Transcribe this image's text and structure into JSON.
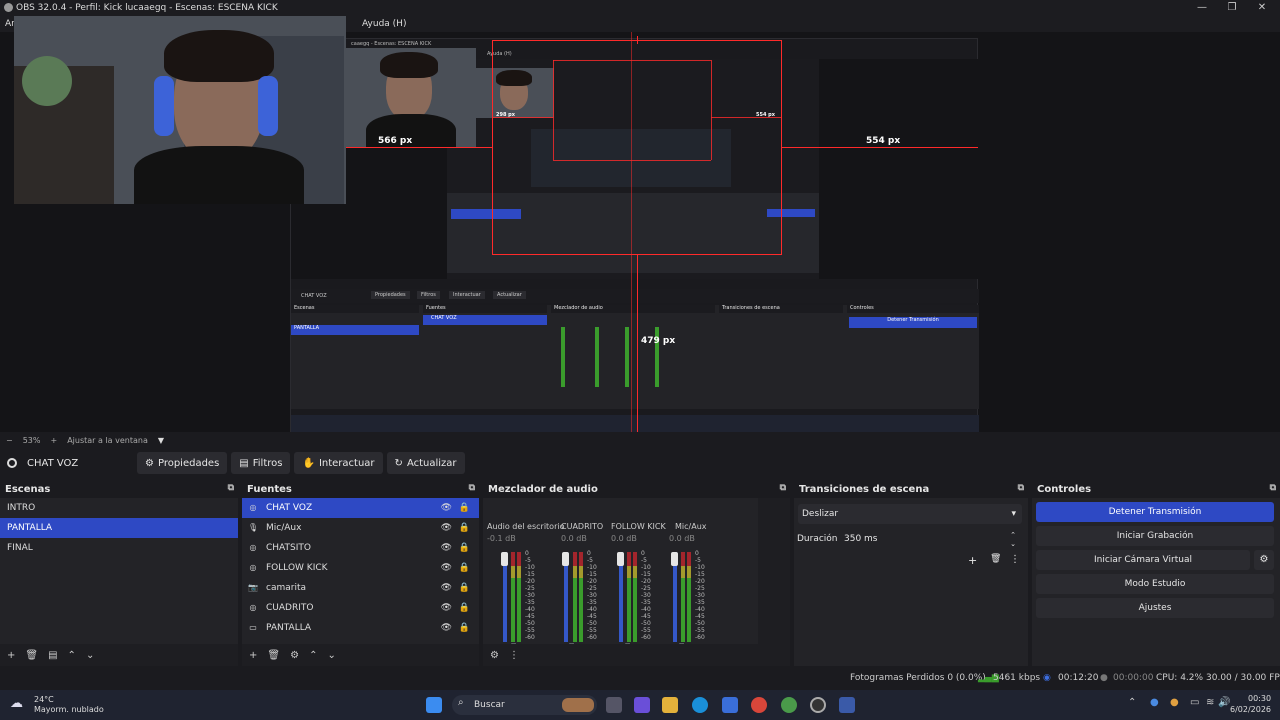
{
  "window": {
    "title": "OBS 32.0.4 - Perfil: Kick lucaaegq - Escenas: ESCENA KICK",
    "menu_help": "Ayuda (H)",
    "menu_first": "Ar"
  },
  "preview": {
    "px_left": "566 px",
    "px_right": "554 px",
    "px_bottom": "479 px",
    "px_small": "554 px",
    "px_small2": "298 px",
    "nested_title": "caaegq - Escenas: ESCENA KICK",
    "nested_help": "Ayuda (H)"
  },
  "zoom": {
    "minus": "−",
    "value": "53%",
    "plus": "+",
    "fit_label": "Ajustar a la ventana"
  },
  "toolbar": {
    "current_source": "CHAT VOZ",
    "properties": "Propiedades",
    "filters": "Filtros",
    "interact": "Interactuar",
    "refresh": "Actualizar"
  },
  "scenes": {
    "title": "Escenas",
    "items": [
      "INTRO",
      "PANTALLA",
      "FINAL"
    ],
    "selected": "PANTALLA"
  },
  "sources": {
    "title": "Fuentes",
    "items": [
      {
        "label": "CHAT VOZ",
        "icon": "browser-icon"
      },
      {
        "label": "Mic/Aux",
        "icon": "mic-icon"
      },
      {
        "label": "CHATSITO",
        "icon": "browser-icon"
      },
      {
        "label": "FOLLOW KICK",
        "icon": "browser-icon"
      },
      {
        "label": "camarita",
        "icon": "camera-icon"
      },
      {
        "label": "CUADRITO",
        "icon": "browser-icon"
      },
      {
        "label": "PANTALLA",
        "icon": "monitor-icon"
      }
    ]
  },
  "mixer": {
    "title": "Mezclador de audio",
    "channels": [
      {
        "name": "Audio del escritorio",
        "db": "-0.1 dB"
      },
      {
        "name": "CUADRITO",
        "db": "0.0 dB"
      },
      {
        "name": "FOLLOW KICK",
        "db": "0.0 dB"
      },
      {
        "name": "Mic/Aux",
        "db": "0.0 dB"
      }
    ],
    "scale": [
      "0",
      "-5",
      "-10",
      "-15",
      "-20",
      "-25",
      "-30",
      "-35",
      "-40",
      "-45",
      "-50",
      "-55",
      "-60"
    ]
  },
  "transitions": {
    "title": "Transiciones de escena",
    "selected": "Deslizar",
    "duration_label": "Duración",
    "duration_value": "350 ms"
  },
  "controls": {
    "title": "Controles",
    "stop_stream": "Detener Transmisión",
    "start_recording": "Iniciar Grabación",
    "start_virtual_cam": "Iniciar Cámara Virtual",
    "studio_mode": "Modo Estudio",
    "settings": "Ajustes"
  },
  "status": {
    "dropped_frames": "Fotogramas Perdidos 0 (0.0%)",
    "bitrate": "5461 kbps",
    "stream_time": "00:12:20",
    "rec_time": "00:00:00",
    "cpu": "CPU: 4.2%",
    "fps": "30.00 / 30.00 FPS"
  },
  "taskbar": {
    "weather_temp": "24°C",
    "weather_desc": "Mayorm. nublado",
    "search": "Buscar",
    "time": "00:30",
    "date": "6/02/2026"
  },
  "colors": {
    "accent": "#2e49c4",
    "guide_red": "#ff2a2a"
  }
}
